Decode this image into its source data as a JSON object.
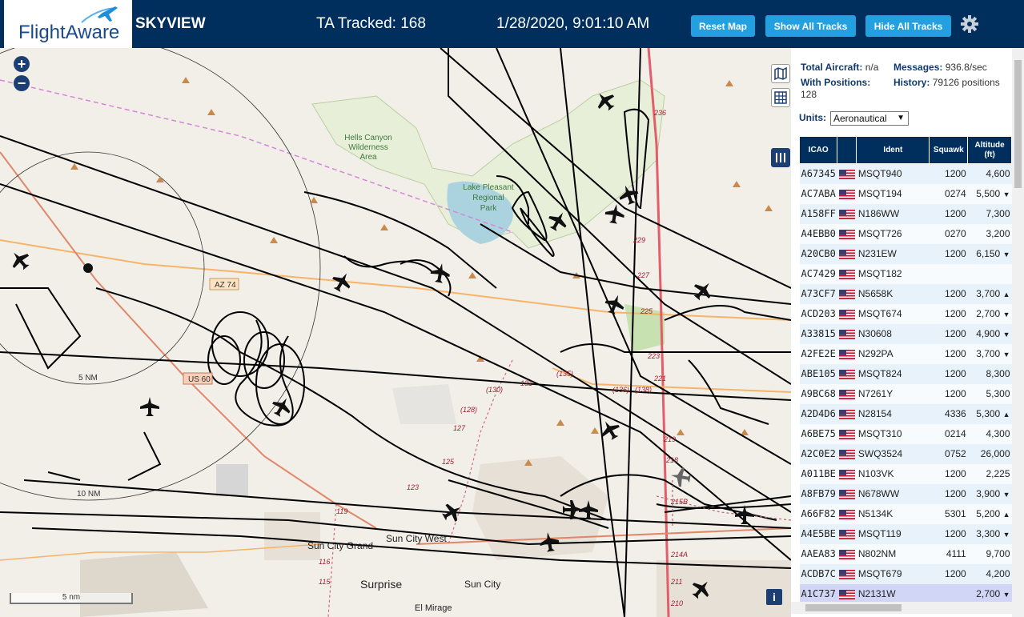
{
  "header": {
    "logo_text": "FlightAware",
    "title": "SKYVIEW",
    "tracked": "TA Tracked: 168",
    "datetime": "1/28/2020, 9:01:10 AM",
    "buttons": {
      "reset": "Reset Map",
      "show": "Show All Tracks",
      "hide": "Hide All Tracks"
    },
    "colors": {
      "bar": "#002f5d",
      "button": "#22a0e0"
    }
  },
  "map": {
    "labels": {
      "hells_canyon": "Hells Canyon",
      "wilderness": "Wilderness",
      "area": "Area",
      "lake": "Lake Pleasant",
      "regional": "Regional",
      "park": "Park",
      "az74": "AZ 74",
      "us60": "US 60",
      "nm5": "5 NM",
      "nm10": "10 NM",
      "sun_city_grand": "Sun City Grand",
      "sun_city_west": "Sun City West",
      "sun_city": "Sun City",
      "surprise": "Surprise",
      "el_mirage": "El Mirage",
      "r119": "119",
      "r116": "116",
      "r115": "115",
      "r123": "123",
      "r125": "125",
      "r127": "127",
      "r128": "(128)",
      "r130": "(130)",
      "r131": "131",
      "r135": "(135)",
      "r136": "(136)",
      "r138": "(138)",
      "r218": "218",
      "r219": "219",
      "r221": "221",
      "r223": "223",
      "r225": "225",
      "r227": "227",
      "r229": "229",
      "r211": "211",
      "r210": "210",
      "r214": "214A",
      "r215": "215B",
      "r236": "236"
    },
    "scale": "5 nm",
    "info": "i"
  },
  "stats": {
    "total_label": "Total Aircraft:",
    "total_value": "n/a",
    "messages_label": "Messages:",
    "messages_value": "936.8/sec",
    "positions_label": "With Positions:",
    "positions_value": "128",
    "history_label": "History:",
    "history_value": "79126 positions",
    "units_label": "Units:",
    "units_value": "Aeronautical"
  },
  "table": {
    "headers": [
      "ICAO",
      "",
      "Ident",
      "Squawk",
      "Altitude (ft)"
    ],
    "rows": [
      {
        "icao": "A67345",
        "ident": "MSQT940",
        "squawk": "1200",
        "alt": "4,600",
        "trend": ""
      },
      {
        "icao": "AC7ABA",
        "ident": "MSQT194",
        "squawk": "0274",
        "alt": "5,500",
        "trend": "▼"
      },
      {
        "icao": "A158FF",
        "ident": "N186WW",
        "squawk": "1200",
        "alt": "7,300",
        "trend": ""
      },
      {
        "icao": "A4EBB0",
        "ident": "MSQT726",
        "squawk": "0270",
        "alt": "3,200",
        "trend": ""
      },
      {
        "icao": "A20CB0",
        "ident": "N231EW",
        "squawk": "1200",
        "alt": "6,150",
        "trend": "▼"
      },
      {
        "icao": "AC7429",
        "ident": "MSQT182",
        "squawk": "",
        "alt": "",
        "trend": ""
      },
      {
        "icao": "A73CF7",
        "ident": "N5658K",
        "squawk": "1200",
        "alt": "3,700",
        "trend": "▲"
      },
      {
        "icao": "ACD203",
        "ident": "MSQT674",
        "squawk": "1200",
        "alt": "2,700",
        "trend": "▼"
      },
      {
        "icao": "A33815",
        "ident": "N30608",
        "squawk": "1200",
        "alt": "4,900",
        "trend": "▼"
      },
      {
        "icao": "A2FE2E",
        "ident": "N292PA",
        "squawk": "1200",
        "alt": "3,700",
        "trend": "▼"
      },
      {
        "icao": "ABE105",
        "ident": "MSQT824",
        "squawk": "1200",
        "alt": "8,300",
        "trend": ""
      },
      {
        "icao": "A9BC68",
        "ident": "N7261Y",
        "squawk": "1200",
        "alt": "5,300",
        "trend": ""
      },
      {
        "icao": "A2D4D6",
        "ident": "N28154",
        "squawk": "4336",
        "alt": "5,300",
        "trend": "▲"
      },
      {
        "icao": "A6BE75",
        "ident": "MSQT310",
        "squawk": "0214",
        "alt": "4,300",
        "trend": ""
      },
      {
        "icao": "A2C0E2",
        "ident": "SWQ3524",
        "squawk": "0752",
        "alt": "26,000",
        "trend": ""
      },
      {
        "icao": "A011BE",
        "ident": "N103VK",
        "squawk": "1200",
        "alt": "2,225",
        "trend": ""
      },
      {
        "icao": "A8FB79",
        "ident": "N678WW",
        "squawk": "1200",
        "alt": "3,900",
        "trend": "▼"
      },
      {
        "icao": "A66F82",
        "ident": "N5134K",
        "squawk": "5301",
        "alt": "5,200",
        "trend": "▲"
      },
      {
        "icao": "A4E5BE",
        "ident": "MSQT119",
        "squawk": "1200",
        "alt": "3,300",
        "trend": "▼"
      },
      {
        "icao": "AAEA83",
        "ident": "N802NM",
        "squawk": "4111",
        "alt": "9,700",
        "trend": ""
      },
      {
        "icao": "ACDB7C",
        "ident": "MSQT679",
        "squawk": "1200",
        "alt": "4,200",
        "trend": ""
      },
      {
        "icao": "A1C737",
        "ident": "N2131W",
        "squawk": "",
        "alt": "2,700",
        "trend": "▼"
      }
    ]
  }
}
